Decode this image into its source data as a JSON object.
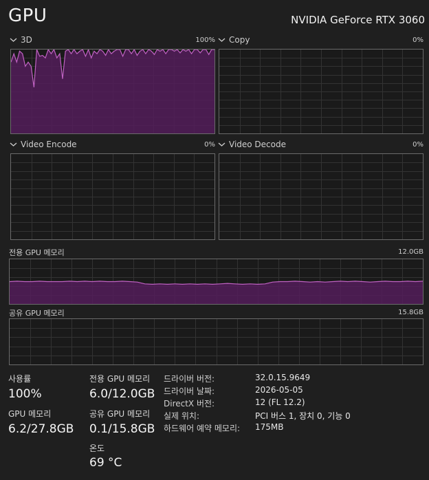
{
  "header": {
    "title": "GPU",
    "gpu_name": "NVIDIA GeForce RTX 3060"
  },
  "colors": {
    "accent": "#c162c4",
    "fill": "#531d5a",
    "grid": "#333333",
    "border": "#6b6b6b",
    "background": "#1f1f1f"
  },
  "engines": [
    {
      "label": "3D",
      "value": "100%",
      "series": [
        85,
        95,
        85,
        98,
        95,
        80,
        85,
        80,
        55,
        100,
        92,
        93,
        90,
        100,
        95,
        100,
        90,
        95,
        65,
        98,
        100,
        95,
        100,
        95,
        98,
        100,
        92,
        100,
        90,
        98,
        95,
        100,
        98,
        93,
        100,
        95,
        98,
        100,
        100,
        92,
        100,
        100,
        95,
        100,
        93,
        98,
        100,
        95,
        100,
        98,
        94,
        100,
        98,
        100,
        95,
        100,
        100,
        98,
        100,
        96,
        100,
        98,
        100,
        95,
        100,
        100,
        96,
        100,
        100,
        94,
        100,
        100
      ]
    },
    {
      "label": "Copy",
      "value": "0%",
      "series": []
    },
    {
      "label": "Video Encode",
      "value": "0%",
      "series": []
    },
    {
      "label": "Video Decode",
      "value": "0%",
      "series": []
    }
  ],
  "dedicated_memory": {
    "label": "전용 GPU 메모리",
    "max": "12.0GB",
    "series": [
      50,
      51,
      50,
      50,
      51,
      50,
      50,
      50,
      51,
      50,
      51,
      50,
      51,
      50,
      50,
      51,
      50,
      49,
      45,
      44,
      45,
      44,
      45,
      44,
      45,
      44,
      45,
      44,
      45,
      46,
      45,
      44,
      45,
      44,
      45,
      49,
      50,
      50,
      51,
      50,
      49,
      50,
      49,
      50,
      51,
      50,
      51,
      50,
      49,
      50,
      51,
      50,
      50,
      51,
      50,
      51
    ]
  },
  "shared_memory": {
    "label": "공유 GPU 메모리",
    "max": "15.8GB",
    "series": []
  },
  "stats": {
    "utilization": {
      "label": "사용률",
      "value": "100%"
    },
    "dedicated": {
      "label": "전용 GPU 메모리",
      "value": "6.0/12.0GB"
    },
    "gpu_memory": {
      "label": "GPU 메모리",
      "value": "6.2/27.8GB"
    },
    "shared": {
      "label": "공유 GPU 메모리",
      "value": "0.1/15.8GB"
    },
    "temperature": {
      "label": "온도",
      "value": "69 °C"
    }
  },
  "info": [
    {
      "label": "드라이버 버전:",
      "value": "32.0.15.9649"
    },
    {
      "label": "드라이버 날짜:",
      "value": "2026-05-05"
    },
    {
      "label": "DirectX 버전:",
      "value": "12 (FL 12.2)"
    },
    {
      "label": "실제 위치:",
      "value": "PCI 버스 1, 장치 0, 기능 0"
    },
    {
      "label": "하드웨어 예약 메모리:",
      "value": "175MB"
    }
  ]
}
